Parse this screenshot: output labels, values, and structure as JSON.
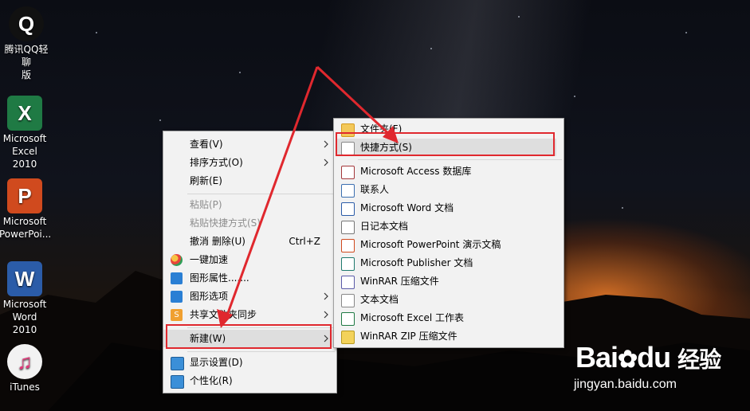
{
  "desktop_icons": [
    {
      "name": "qq",
      "line1": "腾讯QQ轻聊",
      "line2": "版",
      "color": "#111111",
      "glyph": "Q"
    },
    {
      "name": "excel",
      "line1": "Microsoft",
      "line2": "Excel 2010",
      "color": "#1f7a44",
      "glyph": "X"
    },
    {
      "name": "powerpoint",
      "line1": "Microsoft",
      "line2": "PowerPoi...",
      "color": "#d04a1e",
      "glyph": "P"
    },
    {
      "name": "word",
      "line1": "Microsoft",
      "line2": "Word 2010",
      "color": "#2b5ca8",
      "glyph": "W"
    },
    {
      "name": "itunes",
      "line1": "iTunes",
      "line2": "",
      "color": "#f2f2f2",
      "glyph": "♫"
    }
  ],
  "context_menu": {
    "view": "查看(V)",
    "sort": "排序方式(O)",
    "refresh": "刷新(E)",
    "paste": "粘贴(P)",
    "paste_shortcut": "粘贴快捷方式(S)",
    "undo": "撤消 删除(U)",
    "undo_accel": "Ctrl+Z",
    "accelerate": "一键加速",
    "graphics_props": "图形属性.......",
    "graphics_options": "图形选项",
    "share_sync": "共享文件夹同步",
    "new": "新建(W)",
    "display": "显示设置(D)",
    "personalize": "个性化(R)"
  },
  "submenu": {
    "folder": "文件夹(F)",
    "shortcut": "快捷方式(S)",
    "access": "Microsoft Access 数据库",
    "contact": "联系人",
    "word": "Microsoft Word 文档",
    "journal": "日记本文档",
    "ppt": "Microsoft PowerPoint 演示文稿",
    "publisher": "Microsoft Publisher 文档",
    "rar": "WinRAR 压缩文件",
    "txt": "文本文档",
    "excel": "Microsoft Excel 工作表",
    "zip": "WinRAR ZIP 压缩文件"
  },
  "watermark": {
    "brand_a": "Bai",
    "brand_b": "du",
    "brand_cn": "经验",
    "url": "jingyan.baidu.com"
  },
  "colors": {
    "annotation_red": "#e0282e",
    "menu_bg": "#f2f2f2"
  }
}
